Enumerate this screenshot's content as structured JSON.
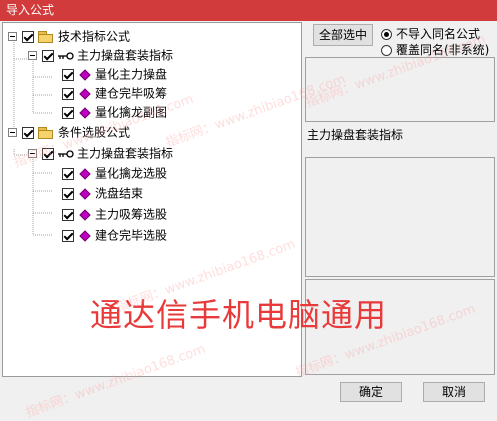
{
  "window": {
    "title": "导入公式"
  },
  "tree": [
    {
      "label": "技术指标公式",
      "icon": "folder-icon"
    },
    {
      "label": "主力操盘套装指标",
      "icon": "key-icon"
    },
    {
      "label": "量化主力操盘",
      "icon": "diamond-icon"
    },
    {
      "label": "建仓完毕吸筹",
      "icon": "diamond-icon"
    },
    {
      "label": "量化擒龙副图",
      "icon": "diamond-icon"
    },
    {
      "label": "条件选股公式",
      "icon": "folder-icon"
    },
    {
      "label": "主力操盘套装指标",
      "icon": "key-icon"
    },
    {
      "label": "量化擒龙选股",
      "icon": "diamond-icon"
    },
    {
      "label": "洗盘结束",
      "icon": "diamond-icon"
    },
    {
      "label": "主力吸筹选股",
      "icon": "diamond-icon"
    },
    {
      "label": "建仓完毕选股",
      "icon": "diamond-icon"
    }
  ],
  "select_all_label": "全部选中",
  "options": {
    "no_import": "不导入同名公式",
    "overwrite": "覆盖同名(非系统)",
    "selected": "no_import"
  },
  "selected_name": "主力操盘套装指标",
  "banner": "通达信手机电脑通用",
  "watermark": "指标网：www.zhibiao168.com",
  "buttons": {
    "ok": "确定",
    "cancel": "取消"
  },
  "colors": {
    "titlebar": "#d13b3b",
    "banner": "#e83a3a",
    "diamond": "#c000c0"
  }
}
